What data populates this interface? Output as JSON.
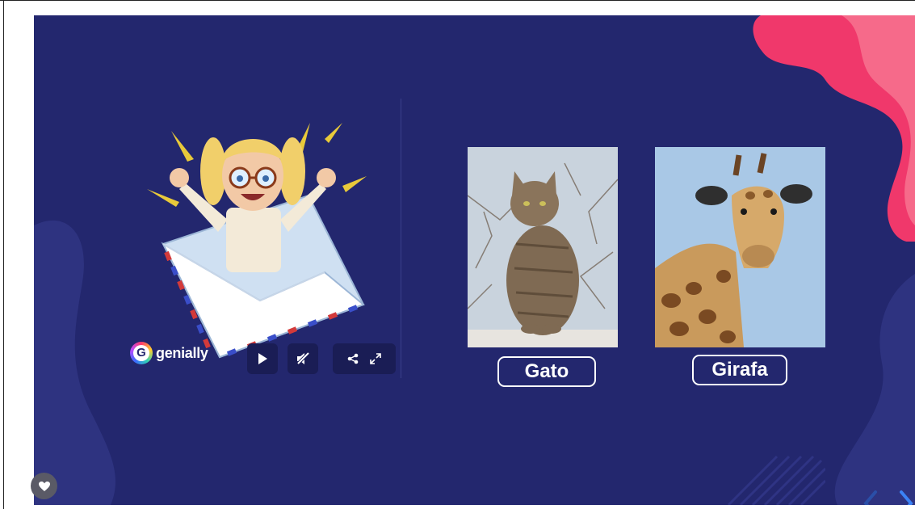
{
  "brand": {
    "logo_text": "genially",
    "logo_letter": "G"
  },
  "controls": {
    "play": {
      "icon": "play-icon"
    },
    "mute": {
      "icon": "mute-icon"
    },
    "share": {
      "icon": "share-icon"
    },
    "fullscreen": {
      "icon": "fullscreen-icon"
    }
  },
  "cards": [
    {
      "label": "Gato",
      "image": "cat-photo"
    },
    {
      "label": "Girafa",
      "image": "giraffe-photo"
    }
  ],
  "footer": {
    "like_icon": "heart-icon",
    "prev_icon": "chevron-left-icon",
    "next_icon": "chevron-right-icon"
  },
  "colors": {
    "slide_bg": "#23276e",
    "accent_pink": "#f0386b",
    "blob_light": "#2e3380",
    "nav_arrow": "#3b82f6"
  }
}
